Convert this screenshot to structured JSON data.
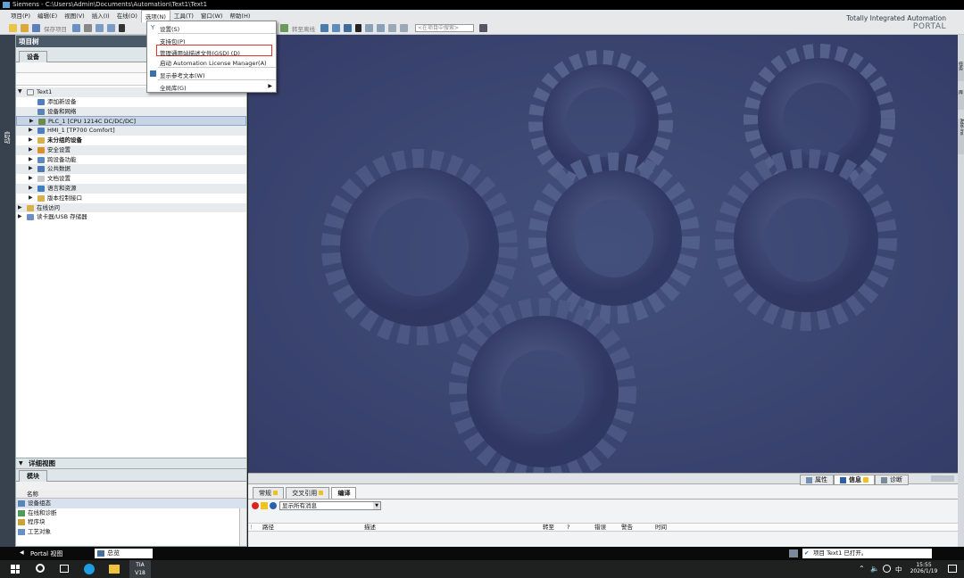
{
  "window": {
    "title": "Siemens - C:\\Users\\Admin\\Documents\\Automation\\Text1\\Text1"
  },
  "menubar": [
    {
      "label": "项目(P)"
    },
    {
      "label": "编辑(E)"
    },
    {
      "label": "视图(V)"
    },
    {
      "label": "插入(I)"
    },
    {
      "label": "在线(O)"
    },
    {
      "label": "选项(N)"
    },
    {
      "label": "工具(T)"
    },
    {
      "label": "窗口(W)"
    },
    {
      "label": "帮助(H)"
    }
  ],
  "toolbar": {
    "save_project": "保存项目",
    "go_offline": "转至离线",
    "search_placeholder": "<在项目中搜索>"
  },
  "brand": {
    "line1": "Totally Integrated Automation",
    "line2": "PORTAL"
  },
  "options_menu": {
    "items": [
      {
        "label": "设置(S)",
        "icon": "wrench-icon"
      },
      {
        "label": "支持包(P)"
      },
      {
        "label": "管理通用站描述文件(GSD) (D)",
        "highlighted": true
      },
      {
        "label": "启动 Automation License Manager(A)"
      },
      {
        "label": "显示参考文本(W)",
        "icon": "text-icon"
      },
      {
        "label": "全局库(G)",
        "submenu": true
      }
    ]
  },
  "sidebar": {
    "label": "启动"
  },
  "project_tree": {
    "title": "项目树",
    "tab": "设备",
    "items": [
      {
        "label": "Text1",
        "level": 0,
        "arrow": "▼",
        "icon": "project-icon"
      },
      {
        "label": "添加新设备",
        "level": 1,
        "arrow": "",
        "icon": "add-device-icon"
      },
      {
        "label": "设备和网络",
        "level": 1,
        "arrow": "",
        "icon": "network-icon"
      },
      {
        "label": "PLC_1 [CPU 1214C DC/DC/DC]",
        "level": 1,
        "arrow": "▶",
        "icon": "plc-icon",
        "selected": true
      },
      {
        "label": "HMI_1 [TP700 Comfort]",
        "level": 1,
        "arrow": "▶",
        "icon": "hmi-icon"
      },
      {
        "label": "未分组的设备",
        "level": 1,
        "arrow": "▶",
        "icon": "folder-icon",
        "bold": true
      },
      {
        "label": "安全设置",
        "level": 1,
        "arrow": "▶",
        "icon": "security-icon"
      },
      {
        "label": "跨设备功能",
        "level": 1,
        "arrow": "▶",
        "icon": "cross-device-icon"
      },
      {
        "label": "公共数据",
        "level": 1,
        "arrow": "▶",
        "icon": "common-data-icon"
      },
      {
        "label": "文档设置",
        "level": 1,
        "arrow": "▶",
        "icon": "document-icon"
      },
      {
        "label": "语言和资源",
        "level": 1,
        "arrow": "▶",
        "icon": "language-icon"
      },
      {
        "label": "版本控制接口",
        "level": 1,
        "arrow": "▶",
        "icon": "version-control-icon"
      },
      {
        "label": "在线访问",
        "level": 0,
        "arrow": "▶",
        "icon": "online-access-icon"
      },
      {
        "label": "读卡器/USB 存储器",
        "level": 0,
        "arrow": "▶",
        "icon": "card-reader-icon"
      }
    ]
  },
  "details_view": {
    "title": "详细视图",
    "tab": "模块",
    "column": "名称",
    "rows": [
      {
        "label": "设备组态"
      },
      {
        "label": "在线和诊断"
      },
      {
        "label": "程序块"
      },
      {
        "label": "工艺对象"
      }
    ]
  },
  "inspector": {
    "right_tabs": [
      {
        "label": "属性"
      },
      {
        "label": "信息"
      },
      {
        "label": "诊断"
      }
    ],
    "tabs": [
      {
        "label": "常规"
      },
      {
        "label": "交叉引用"
      },
      {
        "label": "编译"
      }
    ],
    "filter": "显示所有消息",
    "columns": [
      {
        "label": "路径"
      },
      {
        "label": "描述"
      },
      {
        "label": "转至"
      },
      {
        "label": "?"
      },
      {
        "label": "错误"
      },
      {
        "label": "警告"
      },
      {
        "label": "时间"
      }
    ]
  },
  "statusbar": {
    "portal_view": "Portal 视图",
    "overview": "总览",
    "status_text": "项目 Text1 已打开。"
  },
  "rightbar": {
    "tab1": "任务",
    "tab2": "库",
    "tab3": "Add-ins"
  },
  "taskbar": {
    "tia_label": "TIA",
    "tia_version": "V18",
    "lang": "中",
    "time": "15:55",
    "date": "2026/1/19"
  },
  "colors": {
    "canvas": "#3c4570",
    "panel_header": "#4b5a68",
    "highlight_box": "#e0352f"
  }
}
